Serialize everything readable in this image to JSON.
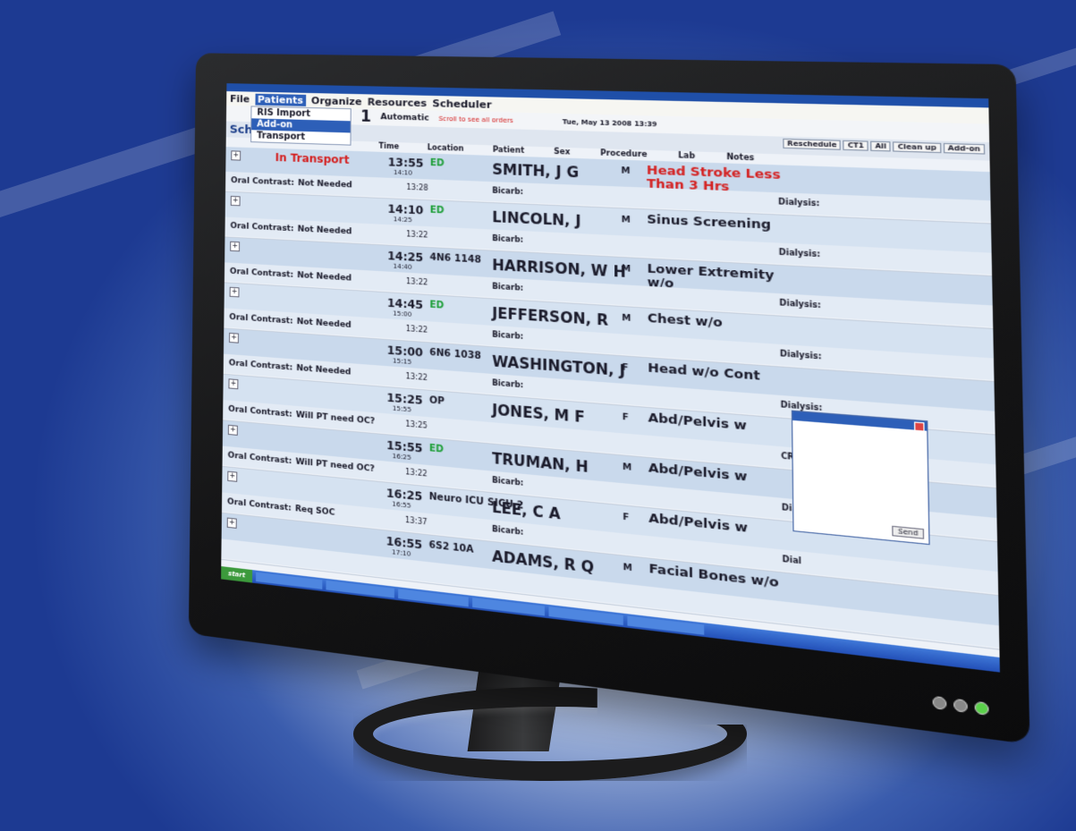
{
  "menu": {
    "items": [
      {
        "label": "File",
        "active": false
      },
      {
        "label": "Patients",
        "active": true
      },
      {
        "label": "Organize",
        "active": false
      },
      {
        "label": "Resources",
        "active": false
      },
      {
        "label": "Scheduler",
        "active": false
      }
    ],
    "submenu": [
      "RIS Import",
      "Add-on",
      "Transport"
    ]
  },
  "toolbar": {
    "count": "1",
    "mode": "Automatic",
    "hint": "Scroll to see all orders",
    "datetime": "Tue, May 13 2008  13:39"
  },
  "header": {
    "title": "Scheduled Orders",
    "buttons": [
      "Reschedule",
      "CT1",
      "All",
      "Clean up",
      "Add-on"
    ],
    "columns": [
      "Time",
      "Location",
      "Patient",
      "Sex",
      "Procedure",
      "Lab",
      "Notes"
    ]
  },
  "rows": [
    {
      "status": "In Transport",
      "time": "13:55",
      "sub": "14:10",
      "loc": "ED",
      "loc_green": true,
      "patient": "SMITH, J G",
      "sex": "M",
      "proc": "Head Stroke Less Than 3 Hrs",
      "proc_red": true,
      "oc": "Not Needed",
      "t2": "13:28",
      "bicarb": "Bicarb:",
      "dial": "Dialysis:"
    },
    {
      "status": "",
      "time": "14:10",
      "sub": "14:25",
      "loc": "ED",
      "loc_green": true,
      "patient": "LINCOLN, J",
      "sex": "M",
      "proc": "Sinus Screening",
      "proc_red": false,
      "oc": "Not Needed",
      "t2": "13:22",
      "bicarb": "Bicarb:",
      "dial": "Dialysis:"
    },
    {
      "status": "",
      "time": "14:25",
      "sub": "14:40",
      "loc": "4N6 1148",
      "loc_green": false,
      "patient": "HARRISON, W H",
      "sex": "M",
      "proc": "Lower Extremity w/o",
      "proc_red": false,
      "oc": "Not Needed",
      "t2": "13:22",
      "bicarb": "Bicarb:",
      "dial": "Dialysis:"
    },
    {
      "status": "",
      "time": "14:45",
      "sub": "15:00",
      "loc": "ED",
      "loc_green": true,
      "patient": "JEFFERSON, R",
      "sex": "M",
      "proc": "Chest w/o",
      "proc_red": false,
      "oc": "Not Needed",
      "t2": "13:22",
      "bicarb": "Bicarb:",
      "dial": "Dialysis:"
    },
    {
      "status": "",
      "time": "15:00",
      "sub": "15:15",
      "loc": "6N6 1038",
      "loc_green": false,
      "patient": "WASHINGTON, J",
      "sex": "F",
      "proc": "Head w/o Cont",
      "proc_red": false,
      "oc": "Not Needed",
      "t2": "13:22",
      "bicarb": "Bicarb:",
      "dial": "Dialysis:"
    },
    {
      "status": "",
      "time": "15:25",
      "sub": "15:55",
      "loc": "OP",
      "loc_green": false,
      "patient": "JONES, M F",
      "sex": "F",
      "proc": "Abd/Pelvis w",
      "proc_red": false,
      "oc": "Will PT need OC?",
      "t2": "13:25",
      "bicarb": "",
      "dial": "CREAT"
    },
    {
      "status": "",
      "time": "15:55",
      "sub": "16:25",
      "loc": "ED",
      "loc_green": true,
      "patient": "TRUMAN, H",
      "sex": "M",
      "proc": "Abd/Pelvis w",
      "proc_red": false,
      "oc": "Will PT need OC?",
      "t2": "13:22",
      "bicarb": "Bicarb:",
      "dial": "Dial"
    },
    {
      "status": "",
      "time": "16:25",
      "sub": "16:55",
      "loc": "Neuro ICU SICU 2",
      "loc_green": false,
      "patient": "LEE, C A",
      "sex": "F",
      "proc": "Abd/Pelvis w",
      "proc_red": false,
      "oc": "Req SOC",
      "t2": "13:37",
      "bicarb": "Bicarb:",
      "dial": "Dial"
    },
    {
      "status": "",
      "time": "16:55",
      "sub": "17:10",
      "loc": "6S2 10A",
      "loc_green": false,
      "patient": "ADAMS, R Q",
      "sex": "M",
      "proc": "Facial Bones w/o",
      "proc_red": false,
      "oc": "",
      "t2": "",
      "bicarb": "",
      "dial": ""
    }
  ],
  "labels": {
    "oral_contrast": "Oral Contrast:"
  },
  "popup": {
    "send": "Send"
  },
  "taskbar": {
    "start": "start"
  }
}
